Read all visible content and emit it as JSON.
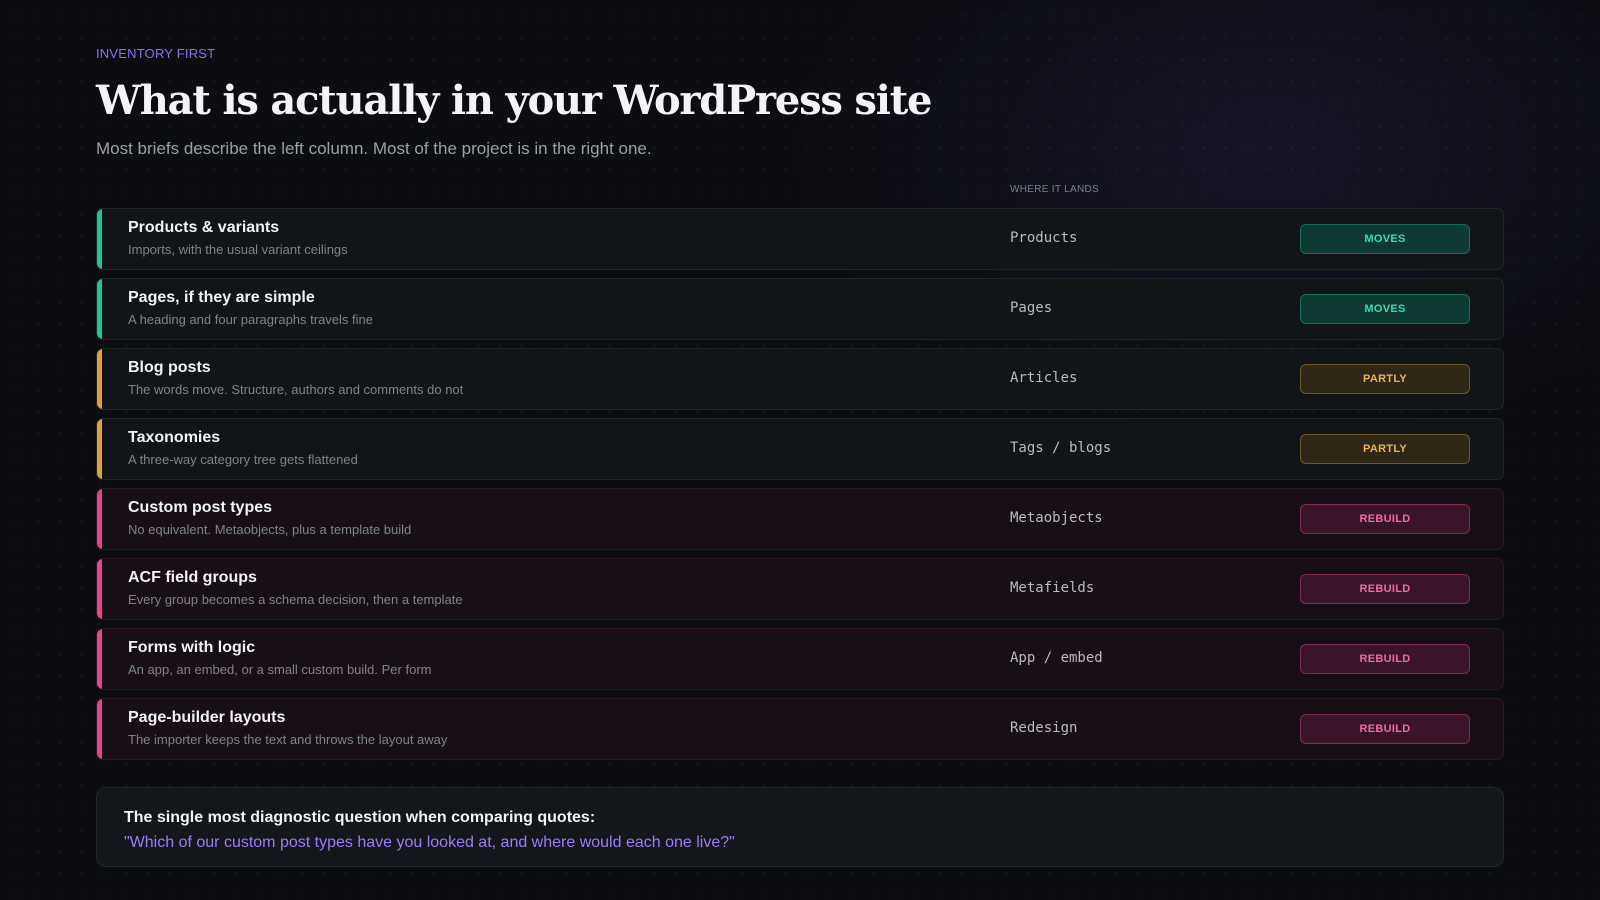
{
  "header": {
    "eyebrow": "INVENTORY FIRST",
    "title": "What is actually in your WordPress site",
    "subtitle": "Most briefs describe the left column. Most of the project is in the right one."
  },
  "table": {
    "column_header": "WHERE IT LANDS",
    "rows": [
      {
        "name": "Products & variants",
        "description": "Imports, with the usual variant ceilings",
        "destination": "Products",
        "status": "MOVES",
        "kind": "moves"
      },
      {
        "name": "Pages, if they are simple",
        "description": "A heading and four paragraphs travels fine",
        "destination": "Pages",
        "status": "MOVES",
        "kind": "moves"
      },
      {
        "name": "Blog posts",
        "description": "The words move. Structure, authors and comments do not",
        "destination": "Articles",
        "status": "PARTLY",
        "kind": "partly"
      },
      {
        "name": "Taxonomies",
        "description": "A three-way category tree gets flattened",
        "destination": "Tags / blogs",
        "status": "PARTLY",
        "kind": "partly"
      },
      {
        "name": "Custom post types",
        "description": "No equivalent. Metaobjects, plus a template build",
        "destination": "Metaobjects",
        "status": "REBUILD",
        "kind": "rebuild"
      },
      {
        "name": "ACF field groups",
        "description": "Every group becomes a schema decision, then a template",
        "destination": "Metafields",
        "status": "REBUILD",
        "kind": "rebuild"
      },
      {
        "name": "Forms with logic",
        "description": "An app, an embed, or a small custom build. Per form",
        "destination": "App / embed",
        "status": "REBUILD",
        "kind": "rebuild"
      },
      {
        "name": "Page-builder layouts",
        "description": "The importer keeps the text and throws the layout away",
        "destination": "Redesign",
        "status": "REBUILD",
        "kind": "rebuild"
      }
    ]
  },
  "status_colors": {
    "moves": "#1fc98e",
    "partly": "#e0a13c",
    "rebuild": "#e2468c"
  },
  "callout": {
    "label": "The single most diagnostic question when comparing quotes:",
    "question": "\"Which of our custom post types have you looked at, and where would each one live?\""
  }
}
